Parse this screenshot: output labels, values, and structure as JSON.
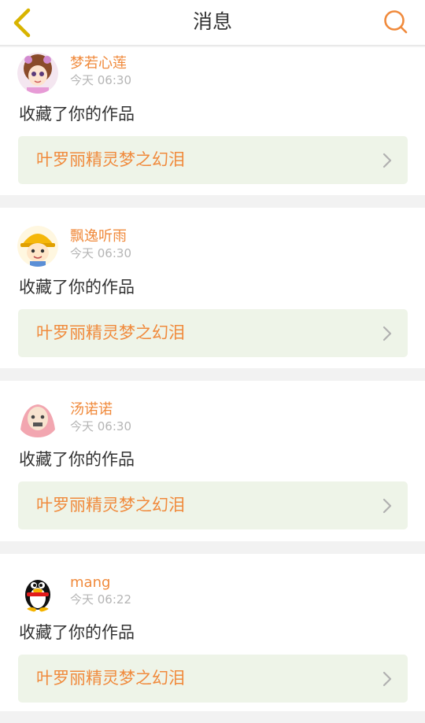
{
  "header": {
    "title": "消息"
  },
  "messages": [
    {
      "user": "梦若心莲",
      "time": "今天 06:30",
      "action": "收藏了你的作品",
      "work": "叶罗丽精灵梦之幻泪",
      "avatar": "girl-avatar"
    },
    {
      "user": "飘逸听雨",
      "time": "今天 06:30",
      "action": "收藏了你的作品",
      "work": "叶罗丽精灵梦之幻泪",
      "avatar": "worker-avatar"
    },
    {
      "user": "汤诺诺",
      "time": "今天 06:30",
      "action": "收藏了你的作品",
      "work": "叶罗丽精灵梦之幻泪",
      "avatar": "meme-avatar"
    },
    {
      "user": "mang",
      "time": "今天 06:22",
      "action": "收藏了你的作品",
      "work": "叶罗丽精灵梦之幻泪",
      "avatar": "penguin-avatar"
    }
  ],
  "colors": {
    "accent": "#f08a3c",
    "back": "#d8b400",
    "card_link_bg": "#eef4e8"
  }
}
